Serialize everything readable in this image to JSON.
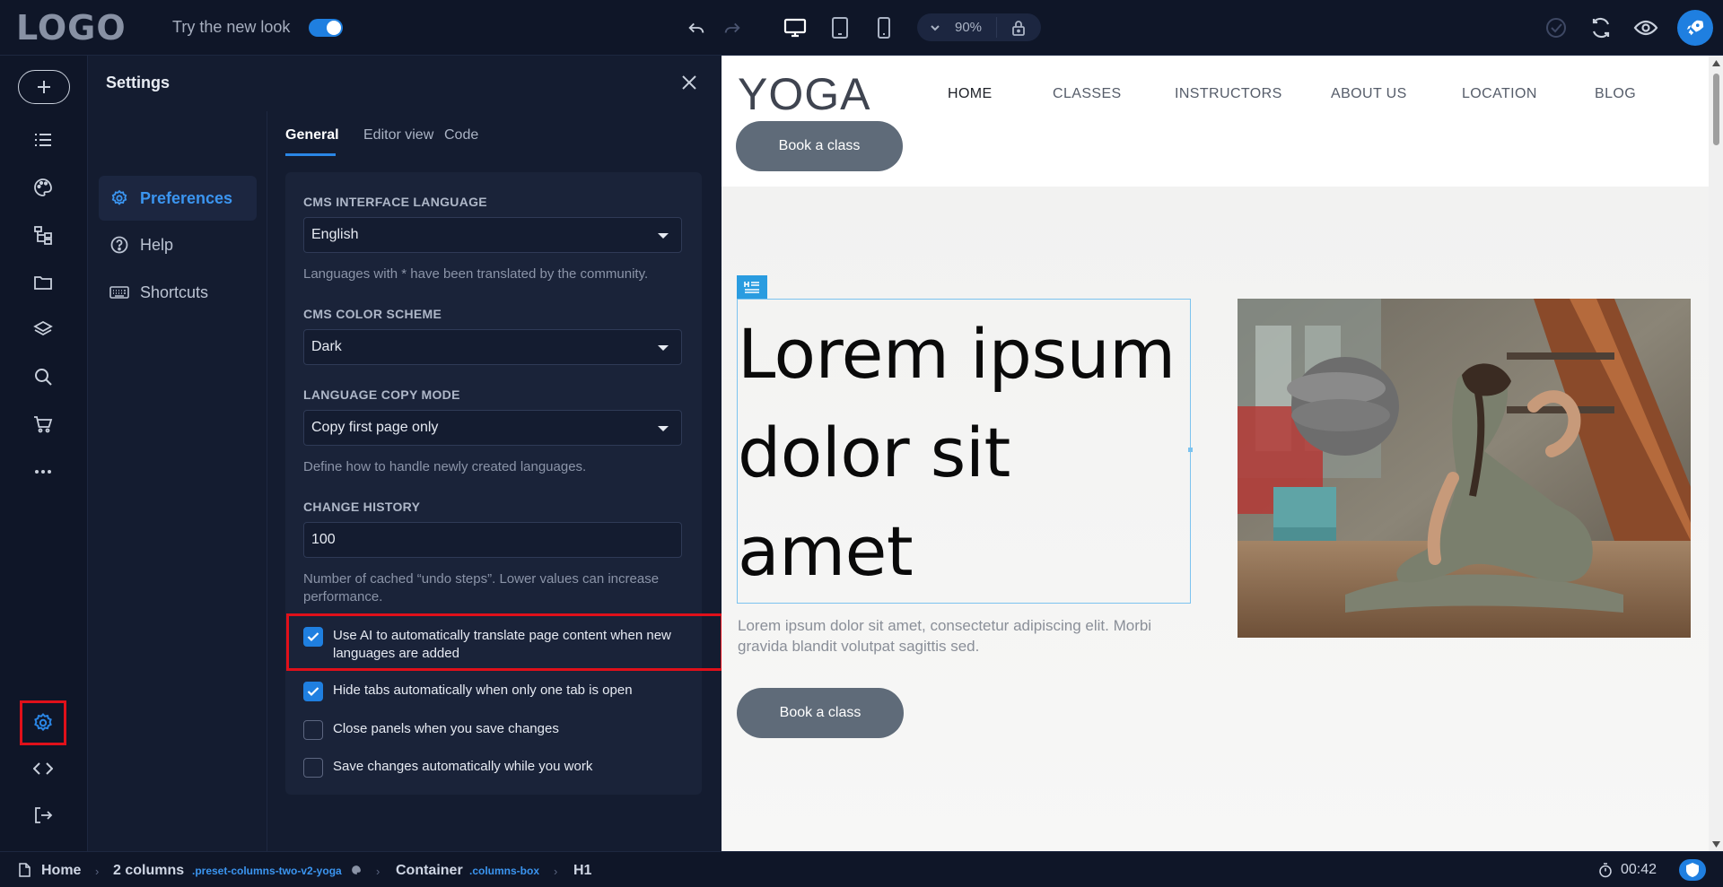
{
  "topbar": {
    "logo": "LOGO",
    "new_look_label": "Try the new look",
    "zoom": "90%"
  },
  "settings": {
    "title": "Settings",
    "nav": [
      {
        "label": "Preferences"
      },
      {
        "label": "Help"
      },
      {
        "label": "Shortcuts"
      }
    ],
    "tabs": [
      {
        "label": "General"
      },
      {
        "label": "Editor view"
      },
      {
        "label": "Code"
      }
    ],
    "cms_language": {
      "label": "CMS INTERFACE LANGUAGE",
      "value": "English",
      "hint": "Languages with * have been translated by the community."
    },
    "color_scheme": {
      "label": "CMS COLOR SCHEME",
      "value": "Dark"
    },
    "copy_mode": {
      "label": "LANGUAGE COPY MODE",
      "value": "Copy first page only",
      "hint": "Define how to handle newly created languages."
    },
    "change_history": {
      "label": "CHANGE HISTORY",
      "value": "100",
      "hint": "Number of cached “undo steps”. Lower values can increase performance."
    },
    "checkboxes": [
      {
        "label": "Use AI to automatically translate page content when new languages are added",
        "checked": true
      },
      {
        "label": "Hide tabs automatically when only one tab is open",
        "checked": true
      },
      {
        "label": "Close panels when you save changes",
        "checked": false
      },
      {
        "label": "Save changes automatically while you work",
        "checked": false
      }
    ]
  },
  "preview": {
    "logo": "YOGA",
    "nav": [
      "HOME",
      "CLASSES",
      "INSTRUCTORS",
      "ABOUT US",
      "LOCATION",
      "BLOG"
    ],
    "header_button": "Book a class",
    "heading": "Lorem ipsum dolor sit amet",
    "paragraph": "Lorem ipsum dolor sit amet, consectetur adipiscing elit. Morbi gravida blandit volutpat sagittis sed.",
    "hero_button": "Book a class"
  },
  "statusbar": {
    "crumbs": [
      {
        "label": "Home"
      },
      {
        "label": "2 columns",
        "cls": ".preset-columns-two-v2-yoga"
      },
      {
        "label": "Container",
        "cls": ".columns-box"
      },
      {
        "label": "H1"
      }
    ],
    "timer": "00:42"
  },
  "colors": {
    "accent": "#1f7fe0",
    "highlight": "#e0101a",
    "background": "#0f1628"
  }
}
